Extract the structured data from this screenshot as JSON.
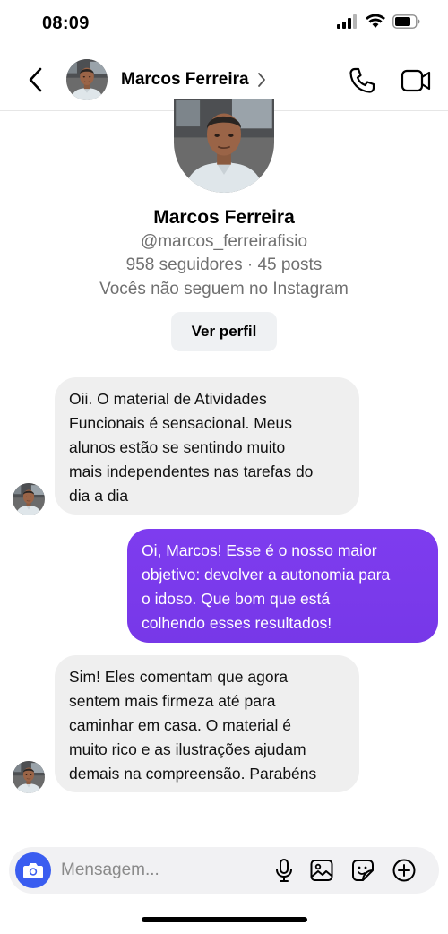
{
  "status_bar": {
    "time": "08:09",
    "icons": [
      "signal-icon",
      "wifi-icon",
      "battery-icon"
    ]
  },
  "header": {
    "name": "Marcos Ferreira",
    "icons": {
      "back": "chevron-left-icon",
      "chevron": "chevron-right-icon",
      "call": "phone-icon",
      "video": "video-camera-icon"
    }
  },
  "profile": {
    "name": "Marcos Ferreira",
    "handle": "@marcos_ferreirafisio",
    "stats": "958 seguidores · 45 posts",
    "follow_status": "Vocês não seguem no Instagram",
    "view_profile_label": "Ver perfil"
  },
  "messages": [
    {
      "direction": "incoming",
      "text": "Oii. O material de Atividades\nFuncionais é sensacional. Meus\nalunos estão se sentindo muito\nmais independentes nas tarefas do\ndia a dia"
    },
    {
      "direction": "outgoing",
      "text": "Oi, Marcos! Esse é o nosso maior\nobjetivo: devolver a autonomia para\no idoso. Que bom que está\ncolhendo esses resultados!"
    },
    {
      "direction": "incoming",
      "text": "Sim! Eles comentam que agora\nsentem mais firmeza até para\ncaminhar em casa. O material é\nmuito rico e as ilustrações ajudam\ndemais na compreensão. Parabéns"
    }
  ],
  "composer": {
    "placeholder": "Mensagem...",
    "icons": [
      "camera-icon",
      "microphone-icon",
      "image-icon",
      "sticker-icon",
      "plus-circle-icon"
    ]
  },
  "colors": {
    "outgoing_bubble": "#7c3aed",
    "incoming_bubble": "#efefef",
    "camera_button": "#3a5df0",
    "secondary_text": "#707070"
  }
}
